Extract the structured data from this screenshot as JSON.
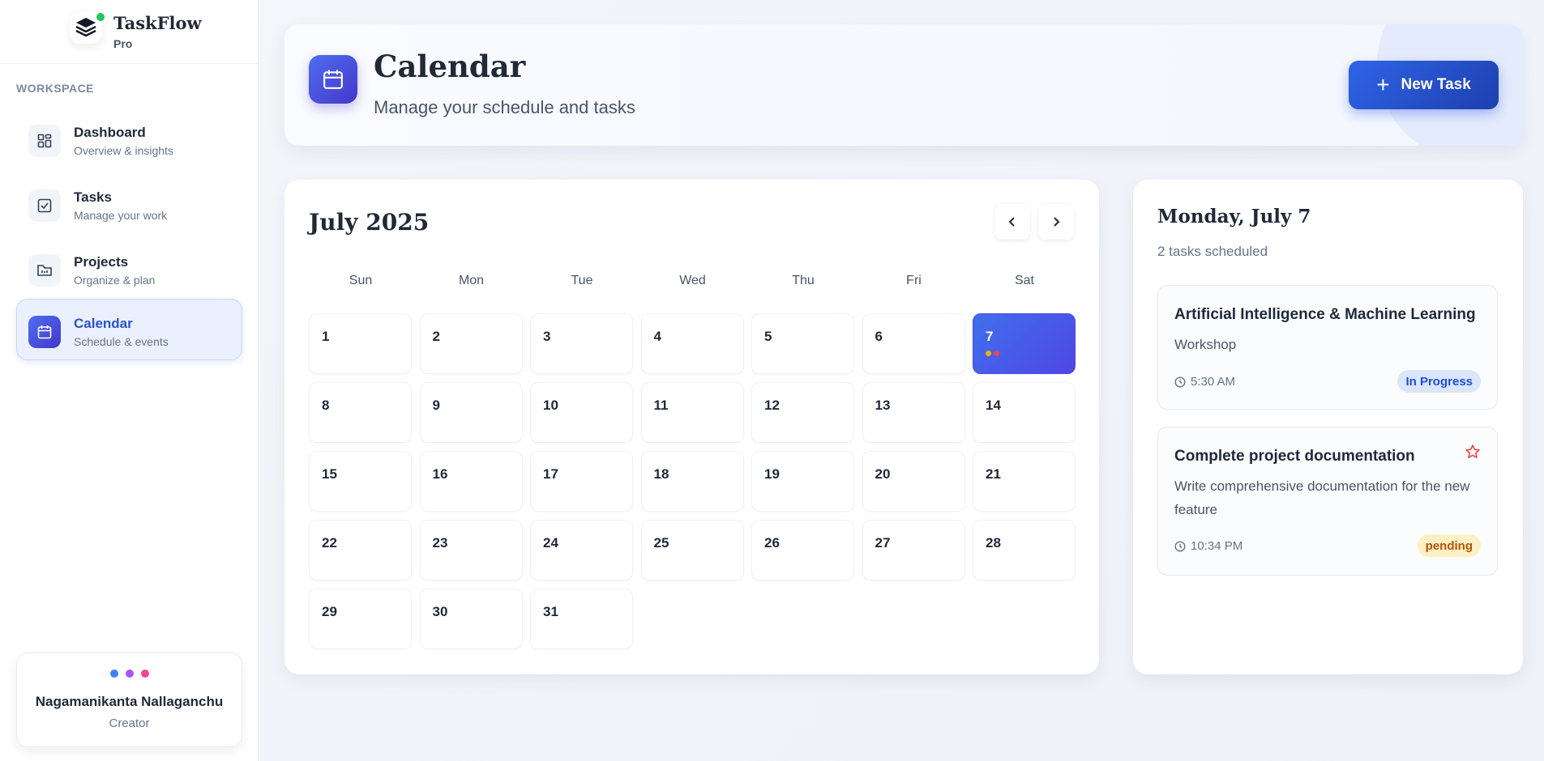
{
  "brand": {
    "name": "TaskFlow",
    "tier": "Pro"
  },
  "sidebar": {
    "section_label": "WORKSPACE",
    "items": [
      {
        "label": "Dashboard",
        "desc": "Overview & insights",
        "icon": "grid-icon"
      },
      {
        "label": "Tasks",
        "desc": "Manage your work",
        "icon": "checkbox-icon"
      },
      {
        "label": "Projects",
        "desc": "Organize & plan",
        "icon": "folder-icon"
      },
      {
        "label": "Calendar",
        "desc": "Schedule & events",
        "icon": "calendar-icon",
        "active": true
      }
    ]
  },
  "user": {
    "name": "Nagamanikanta Nallaganchu",
    "role": "Creator",
    "dot_colors": [
      "#3b82f6",
      "#a855f7",
      "#ec4899"
    ]
  },
  "header": {
    "title": "Calendar",
    "subtitle": "Manage your schedule and tasks",
    "new_task_label": "New Task"
  },
  "calendar": {
    "month_label": "July 2025",
    "weekdays": [
      "Sun",
      "Mon",
      "Tue",
      "Wed",
      "Thu",
      "Fri",
      "Sat"
    ],
    "first_weekday_index": 0,
    "days_in_month": 31,
    "selected_day": 7,
    "day_task_dots": {
      "7": [
        "#eab308",
        "#ef4444"
      ]
    }
  },
  "day_panel": {
    "title": "Monday, July 7",
    "count": "2 tasks scheduled",
    "tasks": [
      {
        "title": "Artificial Intelligence & Machine Learning",
        "desc": "Workshop",
        "time": "5:30 AM",
        "status": "In Progress",
        "starred": false
      },
      {
        "title": "Complete project documentation",
        "desc": "Write comprehensive documentation for the new feature",
        "time": "10:34 PM",
        "status": "pending",
        "starred": true
      }
    ]
  },
  "colors": {
    "accent": "#4f46e5",
    "primary_button": "#2f64e8",
    "status_in_progress_bg": "#dbe6fd",
    "status_in_progress_text": "#1d4ed8",
    "status_pending_bg": "#fdf0c4",
    "status_pending_text": "#b45309",
    "star": "#ef4444"
  }
}
